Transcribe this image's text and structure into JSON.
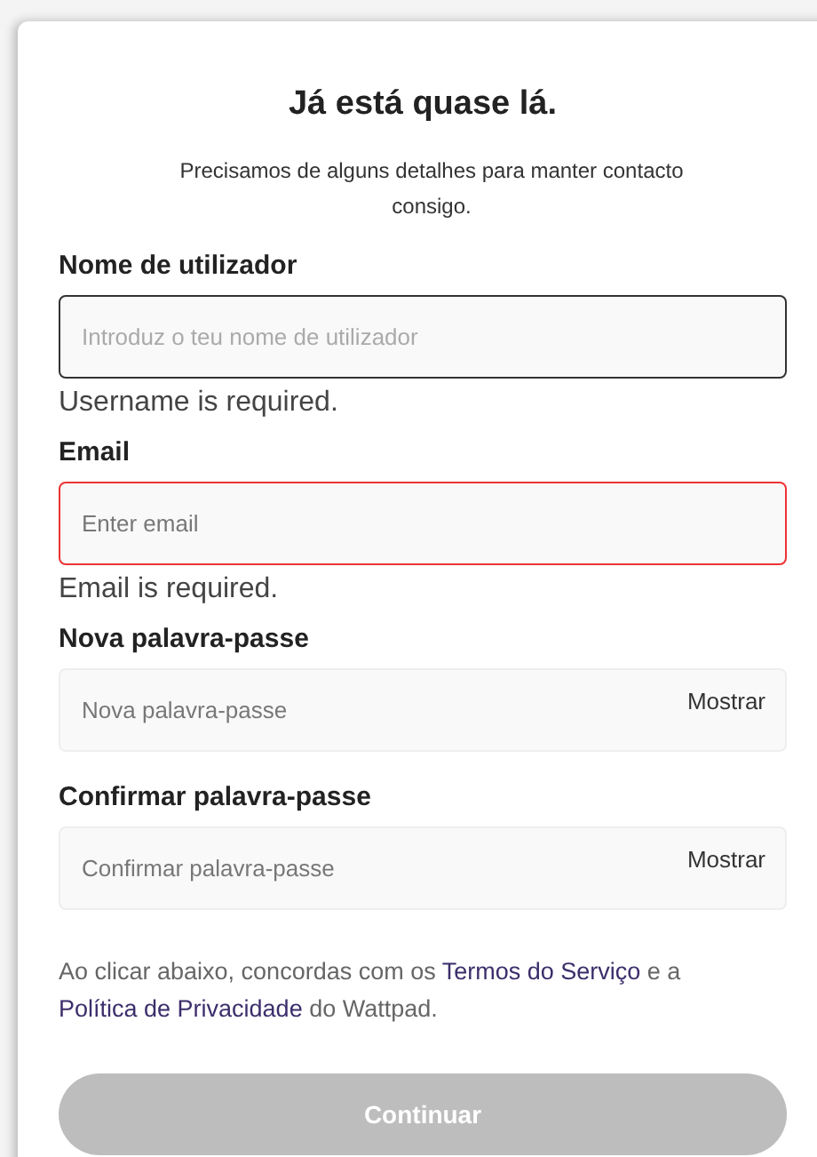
{
  "title": "Já está quase lá.",
  "subtitle": "Precisamos de alguns detalhes para manter contacto consigo.",
  "fields": [
    {
      "label": "Nome de utilizador",
      "placeholder": "Introduz o teu nome de utilizador",
      "kind": "text",
      "focused": true,
      "invalid": false,
      "error": "Username is required."
    },
    {
      "label": "Email",
      "placeholder": "Enter email",
      "kind": "text",
      "focused": false,
      "invalid": true,
      "error": "Email is required."
    },
    {
      "label": "Nova palavra-passe",
      "placeholder": "Nova palavra-passe",
      "kind": "password",
      "focused": false,
      "invalid": false,
      "toggle": "Mostrar"
    },
    {
      "label": "Confirmar palavra-passe",
      "placeholder": "Confirmar palavra-passe",
      "kind": "password",
      "focused": false,
      "invalid": false,
      "toggle": "Mostrar"
    }
  ],
  "legal": [
    {
      "kind": "text",
      "text": "Ao clicar abaixo, concordas com os "
    },
    {
      "kind": "link",
      "text": "Termos do Serviço"
    },
    {
      "kind": "text",
      "text": " e a "
    },
    {
      "kind": "link",
      "text": "Política de Privacidade"
    },
    {
      "kind": "text",
      "text": " do Wattpad."
    }
  ],
  "submit": {
    "label": "Continuar",
    "disabled": true
  }
}
